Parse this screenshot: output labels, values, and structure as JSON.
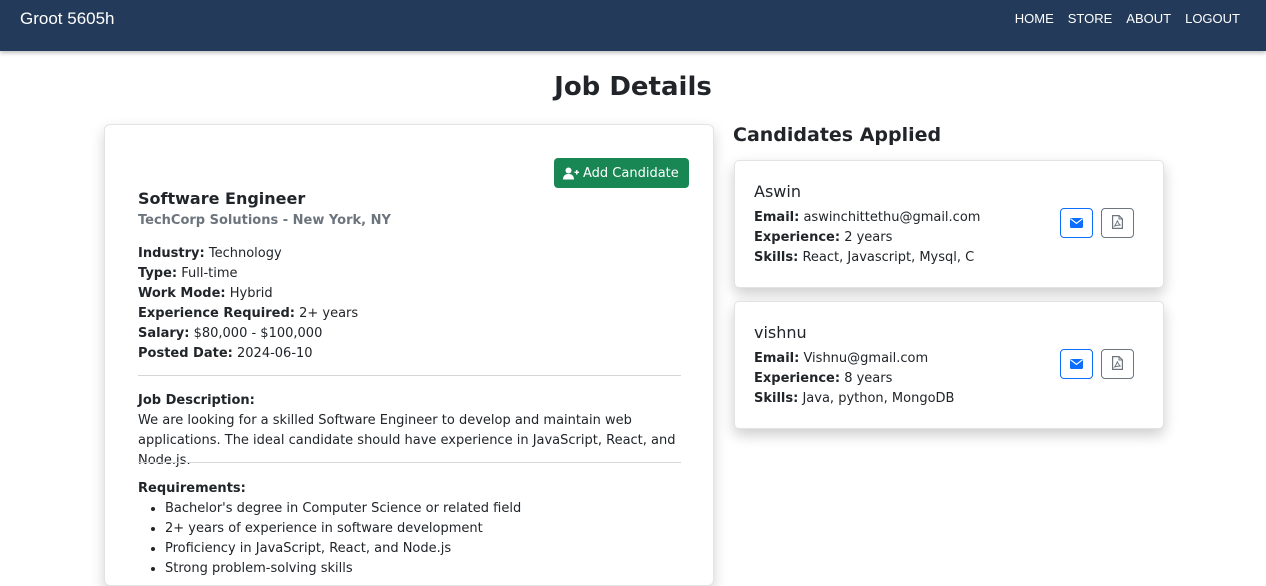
{
  "navbar": {
    "brand": "Groot 5605h",
    "links": [
      "HOME",
      "STORE",
      "ABOUT",
      "LOGOUT"
    ]
  },
  "page_title": "Job Details",
  "job": {
    "add_candidate_label": "Add Candidate",
    "title": "Software Engineer",
    "company": "TechCorp Solutions - New York, NY",
    "industry_label": "Industry:",
    "industry": "Technology",
    "type_label": "Type:",
    "type": "Full-time",
    "work_mode_label": "Work Mode:",
    "work_mode": "Hybrid",
    "experience_label": "Experience Required:",
    "experience": "2+ years",
    "salary_label": "Salary:",
    "salary": "$80,000 - $100,000",
    "posted_label": "Posted Date:",
    "posted": "2024-06-10",
    "description_label": "Job Description:",
    "description": "We are looking for a skilled Software Engineer to develop and maintain web applications. The ideal candidate should have experience in JavaScript, React, and Node.js.",
    "requirements_label": "Requirements:",
    "requirements": [
      "Bachelor's degree in Computer Science or related field",
      "2+ years of experience in software development",
      "Proficiency in JavaScript, React, and Node.js",
      "Strong problem-solving skills"
    ]
  },
  "candidates_title": "Candidates Applied",
  "candidates": [
    {
      "name": "Aswin",
      "email_label": "Email:",
      "email": "aswinchittethu@gmail.com",
      "experience_label": "Experience:",
      "experience": "2 years",
      "skills_label": "Skills:",
      "skills": "React, Javascript, Mysql, C"
    },
    {
      "name": "vishnu",
      "email_label": "Email:",
      "email": "Vishnu@gmail.com",
      "experience_label": "Experience:",
      "experience": "8 years",
      "skills_label": "Skills:",
      "skills": "Java, python, MongoDB"
    }
  ],
  "colors": {
    "navbar": "#243a5a",
    "success": "#198754",
    "primary": "#0d6efd",
    "secondary": "#6c757d"
  },
  "icons": {
    "add_candidate": "user-plus-icon",
    "email": "envelope-icon",
    "resume": "file-pdf-icon"
  }
}
